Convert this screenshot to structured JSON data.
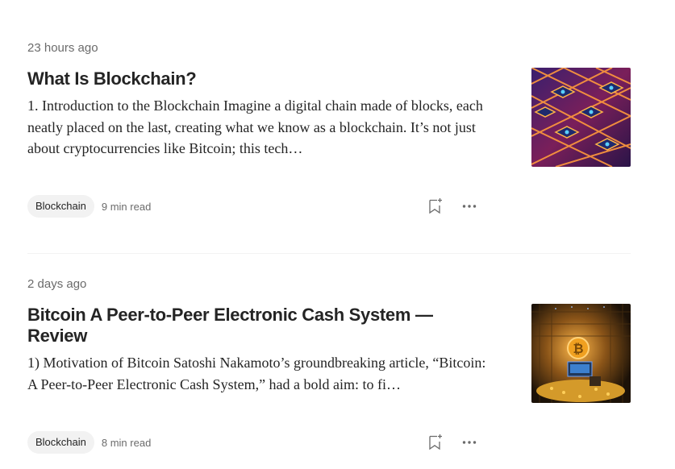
{
  "articles": [
    {
      "date": "23 hours ago",
      "title": "What Is Blockchain?",
      "excerpt": "1. Introduction to the Blockchain Imagine a digital chain made of blocks, each neatly placed on the last, creating what we know as a blockchain. It’s not just about cryptocurrencies like Bitcoin; this tech…",
      "tag": "Blockchain",
      "read_time": "9 min read",
      "thumbnail_icon": "isometric-blocks-image"
    },
    {
      "date": "2 days ago",
      "title": "Bitcoin A Peer-to-Peer Electronic Cash System — Review",
      "excerpt": "1) Motivation of Bitcoin Satoshi Nakamoto’s groundbreaking article, “Bitcoin: A Peer-to-Peer Electronic Cash System,” had a bold aim: to fi…",
      "tag": "Blockchain",
      "read_time": "8 min read",
      "thumbnail_icon": "bitcoin-vault-image"
    }
  ],
  "icons": {
    "save": "bookmark-add-icon",
    "more": "more-horizontal-icon"
  },
  "colors": {
    "text": "#242424",
    "muted": "#6b6b6b",
    "tag_bg": "#f2f2f2"
  }
}
